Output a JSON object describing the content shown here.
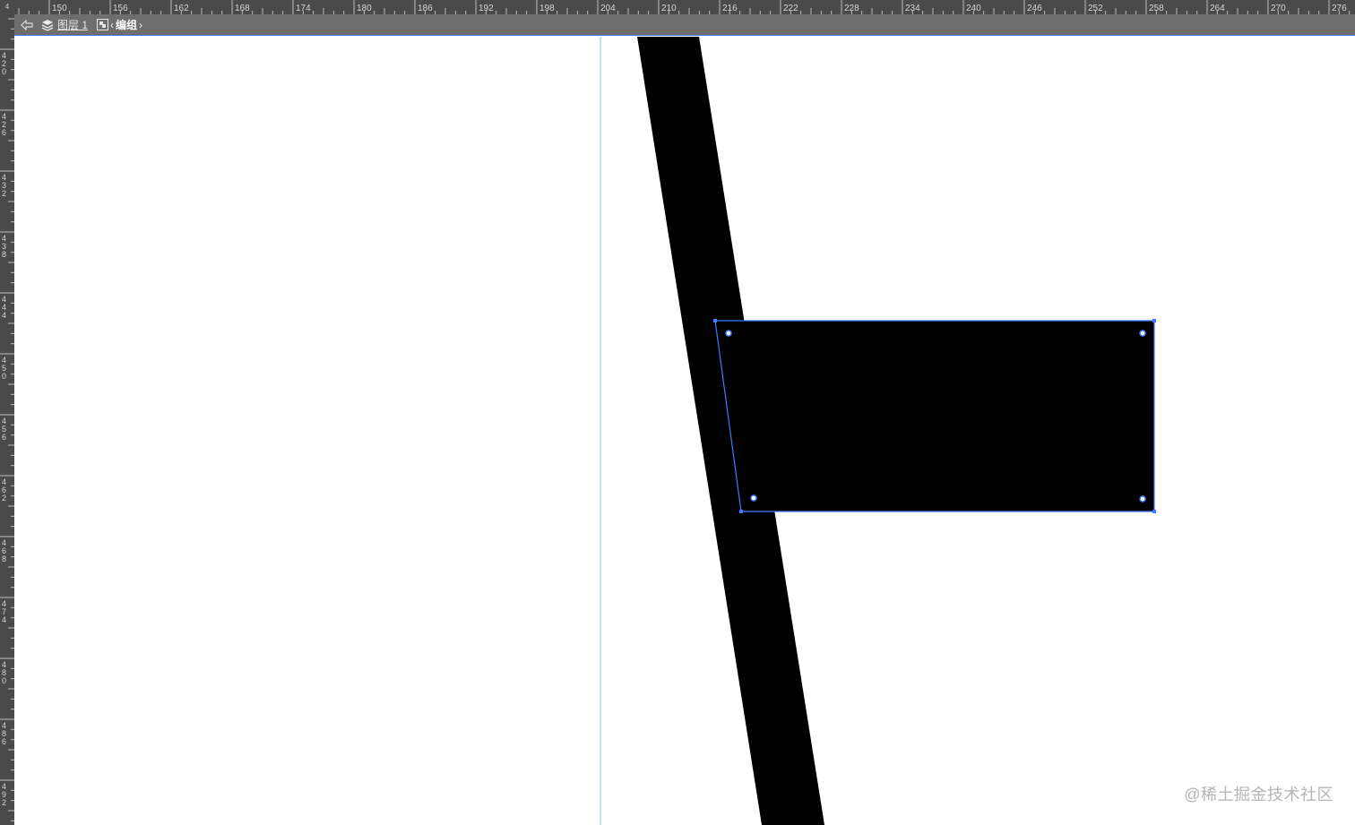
{
  "ruler": {
    "corner_label": "4",
    "top_labels": [
      "150",
      "156",
      "162",
      "168",
      "174",
      "180",
      "186",
      "192",
      "198",
      "204",
      "210",
      "216",
      "222",
      "228",
      "234",
      "240",
      "246",
      "252",
      "258",
      "264",
      "270",
      "276"
    ],
    "left_labels": [
      [
        "4",
        "2",
        "0"
      ],
      [
        "4",
        "2",
        "6"
      ],
      [
        "4",
        "3",
        "2"
      ],
      [
        "4",
        "3",
        "8"
      ],
      [
        "4",
        "4",
        "4"
      ],
      [
        "4",
        "5",
        "0"
      ],
      [
        "4",
        "5",
        "6"
      ],
      [
        "4",
        "6",
        "2"
      ],
      [
        "4",
        "6",
        "8"
      ],
      [
        "4",
        "7",
        "4"
      ],
      [
        "4",
        "8",
        "0"
      ],
      [
        "4",
        "8",
        "6"
      ],
      [
        "4",
        "9",
        "2"
      ]
    ]
  },
  "breadcrumb": {
    "back_icon": "arrow-left-icon",
    "layer_icon": "layers-icon",
    "layer_label": "图层 1",
    "group_icon": "group-icon",
    "group_label": "编组"
  },
  "colors": {
    "ruler_bg": "#4a4a4a",
    "bar_bg": "#6e6e6e",
    "selection": "#3f7bff",
    "guide": "#6ed3f0",
    "shape_fill": "#000000"
  },
  "watermark": "@稀土掘金技术社区"
}
